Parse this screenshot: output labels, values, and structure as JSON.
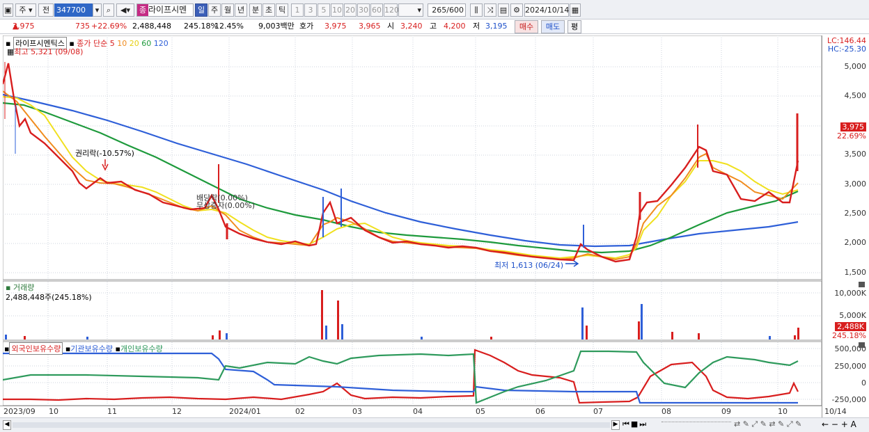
{
  "toolbar": {
    "period_label": "주",
    "prev_label": "전",
    "code": "347700",
    "stock_name": "라이프시멘",
    "stock_tag": "종",
    "timeframes": [
      "일",
      "주",
      "월",
      "년",
      "분",
      "초",
      "틱"
    ],
    "minute_options": [
      "1",
      "3",
      "5",
      "10",
      "20",
      "30",
      "60",
      "120"
    ],
    "count": "265",
    "count_max": "/600",
    "date": "2024/10/14"
  },
  "quote": {
    "price": "3,975",
    "change": "735",
    "change_pct": "+22.69%",
    "volume": "2,488,448",
    "volume_ratio": "245.18%",
    "turnover": "12.45%",
    "amount": "9,003백만",
    "ask_label": "호가",
    "ask": "3,975",
    "bid": "3,965",
    "open_label": "시",
    "open": "3,240",
    "high_label": "고",
    "high": "4,200",
    "low_label": "저",
    "low": "3,195",
    "buy": "매수",
    "sell": "매도",
    "avg": "평"
  },
  "price_panel": {
    "title": "라이프시멘틱스",
    "ma_label": "종가 단순",
    "ma_periods": [
      "5",
      "10",
      "20",
      "60",
      "120"
    ],
    "ma_colors": [
      "#d81e1e",
      "#f08c1e",
      "#f0e01e",
      "#1e9a3c",
      "#2e5fd8"
    ],
    "high_note": "최고 5,321 (09/08)",
    "low_note": "최저 1,613 (06/24)",
    "rights_note": "권리락(-10.57%)",
    "div_note1": "배당락(0.00%)",
    "div_note2": "무상증자(0.00%)",
    "lc": "LC:146.44",
    "hc": "HC:-25.30",
    "price_badge": "3,975",
    "pct_badge": "22.69%",
    "y_ticks": [
      "5,000",
      "4,500",
      "4,000",
      "3,500",
      "3,000",
      "2,500",
      "2,000",
      "1,500"
    ]
  },
  "volume_panel": {
    "title": "거래량",
    "value": "2,488,448주(245.18%)",
    "y_ticks": [
      "10,000K",
      "5,000K"
    ],
    "badge": "2,488K",
    "badge2": "245.18%"
  },
  "holding_panel": {
    "series": [
      "외국인보유수량",
      "기관보유수량",
      "개인보유수량"
    ],
    "y_ticks": [
      "500,000",
      "250,000",
      "0",
      "-250,000"
    ]
  },
  "x_labels": [
    "2023/09",
    "10",
    "11",
    "12",
    "2024/01",
    "02",
    "03",
    "04",
    "05",
    "06",
    "07",
    "08",
    "09",
    "10",
    "10/14"
  ],
  "chart_data": {
    "type": "line",
    "y_range": [
      1500,
      5000
    ],
    "approx_close": [
      4300,
      3700,
      3300,
      3100,
      2950,
      2700,
      2600,
      2500,
      2200,
      2050,
      2000,
      1950,
      2600,
      2200,
      2000,
      2000,
      1950,
      1900,
      1850,
      1750,
      1700,
      2800,
      3500,
      3200,
      2900,
      2800,
      3975
    ],
    "ma120": [
      4550,
      4400,
      4200,
      4000,
      3800,
      3600,
      3400,
      3200,
      3000,
      2850,
      2700,
      2550,
      2400,
      2280,
      2180,
      2080,
      2000,
      1960,
      1970,
      2050,
      2150,
      2230,
      2330
    ],
    "ma60": [
      4350,
      4200,
      4000,
      3800,
      3550,
      3300,
      3050,
      2850,
      2650,
      2450,
      2300,
      2200,
      2150,
      2120,
      2100,
      2050,
      2000,
      1950,
      1900,
      1880,
      1900,
      2100,
      2450,
      2650,
      2850
    ]
  }
}
